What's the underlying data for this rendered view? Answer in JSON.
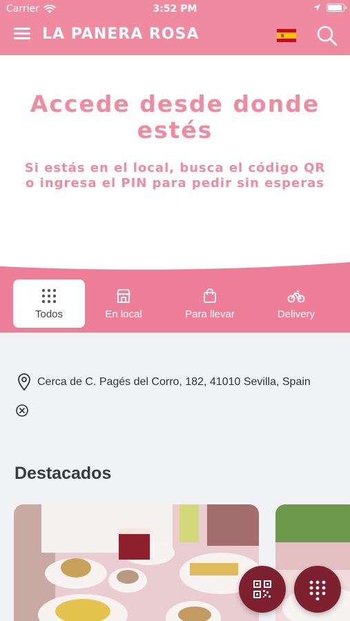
{
  "status_bar": {
    "carrier": "Carrier",
    "time": "3:52 PM"
  },
  "header": {
    "title": "LA PANERA ROSA",
    "language": "Español"
  },
  "hero": {
    "title": "Accede desde donde estés",
    "subtitle": "Si estás en el local, busca el código QR o ingresa el PIN para pedir sin esperas"
  },
  "tabs": [
    {
      "label": "Todos",
      "icon": "grid-icon",
      "active": true
    },
    {
      "label": "En local",
      "icon": "store-icon",
      "active": false
    },
    {
      "label": "Para llevar",
      "icon": "bag-icon",
      "active": false
    },
    {
      "label": "Delivery",
      "icon": "bicycle-icon",
      "active": false
    }
  ],
  "location": {
    "text": "Cerca de C. Pagés del Corro, 182, 41010 Sevilla, Spain"
  },
  "featured": {
    "title": "Destacados"
  },
  "colors": {
    "brand_pink": "#ef8aa0",
    "tab_bar": "#ee7e98",
    "fab": "#7d2131"
  }
}
